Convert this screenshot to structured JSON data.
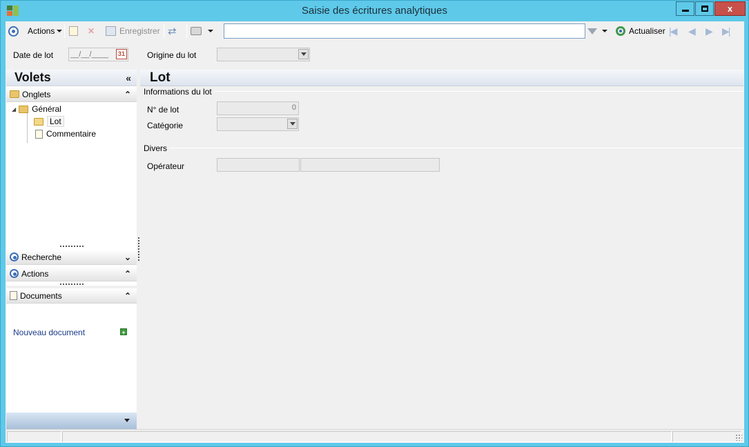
{
  "window": {
    "title": "Saisie des écritures analytiques",
    "buttons": {
      "minimize": "minimize",
      "maximize": "maximize",
      "close": "x"
    }
  },
  "toolbar": {
    "actions_label": "Actions",
    "save_label": "Enregistrer",
    "search_value": "",
    "refresh_label": "Actualiser"
  },
  "header_fields": {
    "date_label": "Date de lot",
    "date_value": "__/__/____",
    "calendar_day": "31",
    "origin_label": "Origine du lot",
    "origin_value": ""
  },
  "left_pane": {
    "title": "Volets",
    "sections": {
      "onglets": "Onglets",
      "recherche": "Recherche",
      "actions": "Actions",
      "documents": "Documents"
    },
    "tree": {
      "general": "Général",
      "lot": "Lot",
      "commentaire": "Commentaire"
    },
    "new_document": "Nouveau document"
  },
  "content": {
    "title": "Lot",
    "group_info": "Informations du lot",
    "lot_number_label": "N° de lot",
    "lot_number_value": "0",
    "category_label": "Catégorie",
    "category_value": "",
    "group_misc": "Divers",
    "operator_label": "Opérateur",
    "operator_code": "",
    "operator_name": ""
  },
  "colors": {
    "window_frame": "#5ec9e9",
    "close_button": "#c7504a",
    "accent_blue": "#3d6fb6"
  }
}
